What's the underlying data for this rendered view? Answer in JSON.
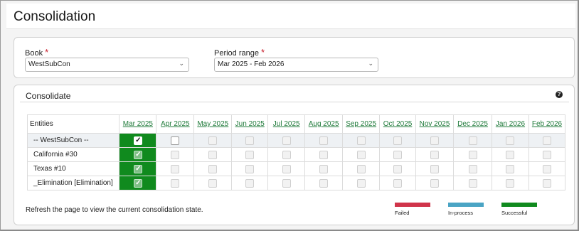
{
  "page": {
    "title": "Consolidation"
  },
  "filters": {
    "book": {
      "label": "Book",
      "required_mark": "*",
      "value": "WestSubCon"
    },
    "period": {
      "label": "Period range",
      "required_mark": "*",
      "value": "Mar 2025 - Feb 2026"
    }
  },
  "consolidate": {
    "title": "Consolidate",
    "help_icon": "?",
    "entities_header": "Entities",
    "periods": [
      "Mar 2025",
      "Apr 2025",
      "May 2025",
      "Jun 2025",
      "Jul 2025",
      "Aug 2025",
      "Sep 2025",
      "Oct 2025",
      "Nov 2025",
      "Dec 2025",
      "Jan 2026",
      "Feb 2026"
    ],
    "rows": [
      {
        "entity": "-- WestSubCon --",
        "states": [
          "successful-checked",
          "empty-active",
          "empty",
          "empty",
          "empty",
          "empty",
          "empty",
          "empty",
          "empty",
          "empty",
          "empty",
          "empty"
        ]
      },
      {
        "entity": "California #30",
        "states": [
          "successful",
          "empty",
          "empty",
          "empty",
          "empty",
          "empty",
          "empty",
          "empty",
          "empty",
          "empty",
          "empty",
          "empty"
        ]
      },
      {
        "entity": "Texas #10",
        "states": [
          "successful",
          "empty",
          "empty",
          "empty",
          "empty",
          "empty",
          "empty",
          "empty",
          "empty",
          "empty",
          "empty",
          "empty"
        ]
      },
      {
        "entity": "_Elimination [Elimination]",
        "states": [
          "successful",
          "empty",
          "empty",
          "empty",
          "empty",
          "empty",
          "empty",
          "empty",
          "empty",
          "empty",
          "empty",
          "empty"
        ]
      }
    ],
    "note": "Refresh the page to view the current consolidation state.",
    "legend": [
      {
        "label": "Failed",
        "color": "#d0344a"
      },
      {
        "label": "In-process",
        "color": "#4aa4c4"
      },
      {
        "label": "Successful",
        "color": "#108a1e"
      }
    ],
    "check_glyph": "✓"
  }
}
